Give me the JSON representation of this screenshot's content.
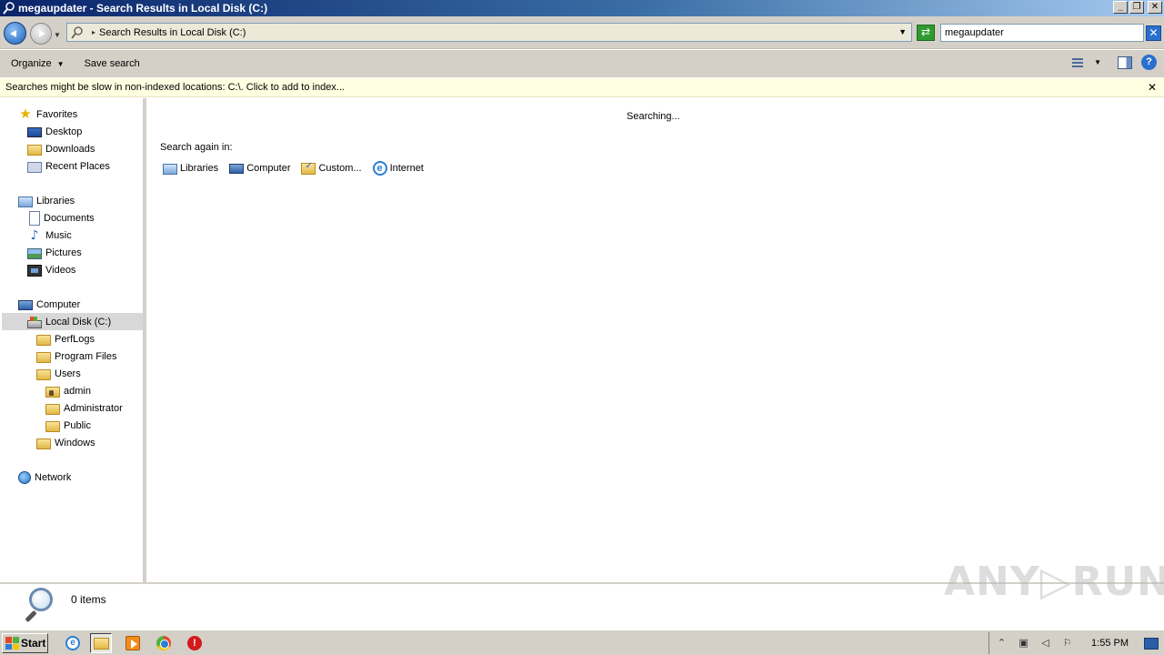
{
  "window": {
    "title": "megaupdater - Search Results in Local Disk (C:)",
    "controls": {
      "minimize": "_",
      "restore": "❐",
      "close": "✕"
    }
  },
  "address_bar": {
    "path": "Search Results in Local Disk (C:)",
    "search_value": "megaupdater",
    "search_clear_glyph": "✕"
  },
  "toolbar": {
    "organize_label": "Organize",
    "save_search_label": "Save search",
    "help_glyph": "?"
  },
  "infobar": {
    "message": "Searches might be slow in non-indexed locations: C:\\. Click to add to index...",
    "close_glyph": "✕"
  },
  "nav_pane": {
    "favorites": {
      "label": "Favorites",
      "items": [
        "Desktop",
        "Downloads",
        "Recent Places"
      ]
    },
    "libraries": {
      "label": "Libraries",
      "items": [
        "Documents",
        "Music",
        "Pictures",
        "Videos"
      ]
    },
    "computer": {
      "label": "Computer",
      "drive": "Local Disk (C:)",
      "folders": [
        "PerfLogs",
        "Program Files",
        "Users"
      ],
      "user_folders": [
        "admin",
        "Administrator",
        "Public"
      ],
      "windows_folder": "Windows"
    },
    "network": {
      "label": "Network"
    }
  },
  "content": {
    "status": "Searching...",
    "search_again_label": "Search again in:",
    "search_again_items": [
      "Libraries",
      "Computer",
      "Custom...",
      "Internet"
    ]
  },
  "details": {
    "items_count": "0 items",
    "watermark": "ANY▷RUN"
  },
  "taskbar": {
    "start_label": "Start",
    "clock": "1:55 PM",
    "stop_glyph": "!"
  }
}
